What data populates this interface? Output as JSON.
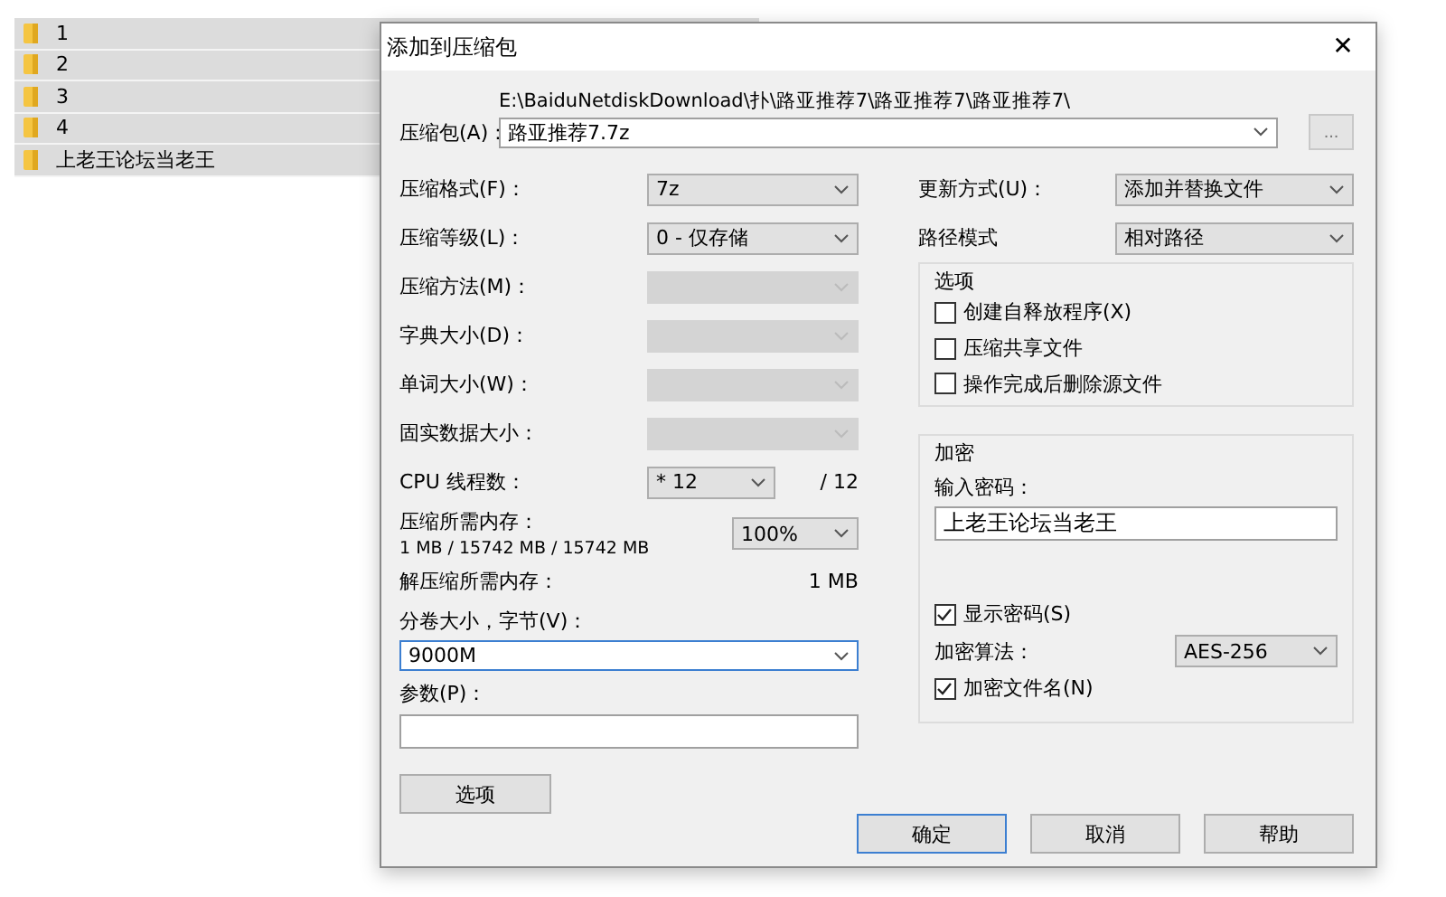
{
  "file_list": {
    "items": [
      {
        "name": "1"
      },
      {
        "name": "2"
      },
      {
        "name": "3"
      },
      {
        "name": "4"
      },
      {
        "name": "上老王论坛当老王"
      }
    ]
  },
  "dialog": {
    "title": "添加到压缩包",
    "close": "✕",
    "archive": {
      "label": "压缩包(A)：",
      "path": "E:\\BaiduNetdiskDownload\\扑\\路亚推荐7\\路亚推荐7\\路亚推荐7\\",
      "value": "路亚推荐7.7z",
      "browse": "..."
    },
    "left_rows": [
      {
        "label": "压缩格式(F)：",
        "value": "7z",
        "disabled": false
      },
      {
        "label": "压缩等级(L)：",
        "value": "0 - 仅存储",
        "disabled": false
      },
      {
        "label": "压缩方法(M)：",
        "disabled": true
      },
      {
        "label": "字典大小(D)：",
        "disabled": true
      },
      {
        "label": "单词大小(W)：",
        "disabled": true
      },
      {
        "label": "固实数据大小：",
        "disabled": true
      }
    ],
    "cpu": {
      "label": "CPU 线程数：",
      "value": "* 12",
      "max": "/ 12"
    },
    "memory": {
      "label": "压缩所需内存：",
      "detail": "1 MB / 15742 MB / 15742 MB",
      "value": "100%"
    },
    "decompress": {
      "label": "解压缩所需内存：",
      "value": "1 MB"
    },
    "volume": {
      "label": "分卷大小，字节(V)：",
      "value": "9000M"
    },
    "params": {
      "label": "参数(P)："
    },
    "options_button": "选项",
    "update": {
      "label": "更新方式(U)：",
      "value": "添加并替换文件"
    },
    "path_mode": {
      "label": "路径模式",
      "value": "相对路径"
    },
    "options": {
      "title": "选项",
      "checkboxes": [
        {
          "label": "创建自释放程序(X)",
          "checked": false
        },
        {
          "label": "压缩共享文件",
          "checked": false
        },
        {
          "label": "操作完成后删除源文件",
          "checked": false
        }
      ]
    },
    "encryption": {
      "title": "加密",
      "password_label": "输入密码：",
      "password": "上老王论坛当老王",
      "show_password": {
        "label": "显示密码(S)",
        "checked": true
      },
      "method": {
        "label": "加密算法：",
        "value": "AES-256"
      },
      "encrypt_names": {
        "label": "加密文件名(N)",
        "checked": true
      }
    },
    "buttons": [
      {
        "label": "确定",
        "default": true
      },
      {
        "label": "取消",
        "default": false
      },
      {
        "label": "帮助",
        "default": false
      }
    ]
  }
}
